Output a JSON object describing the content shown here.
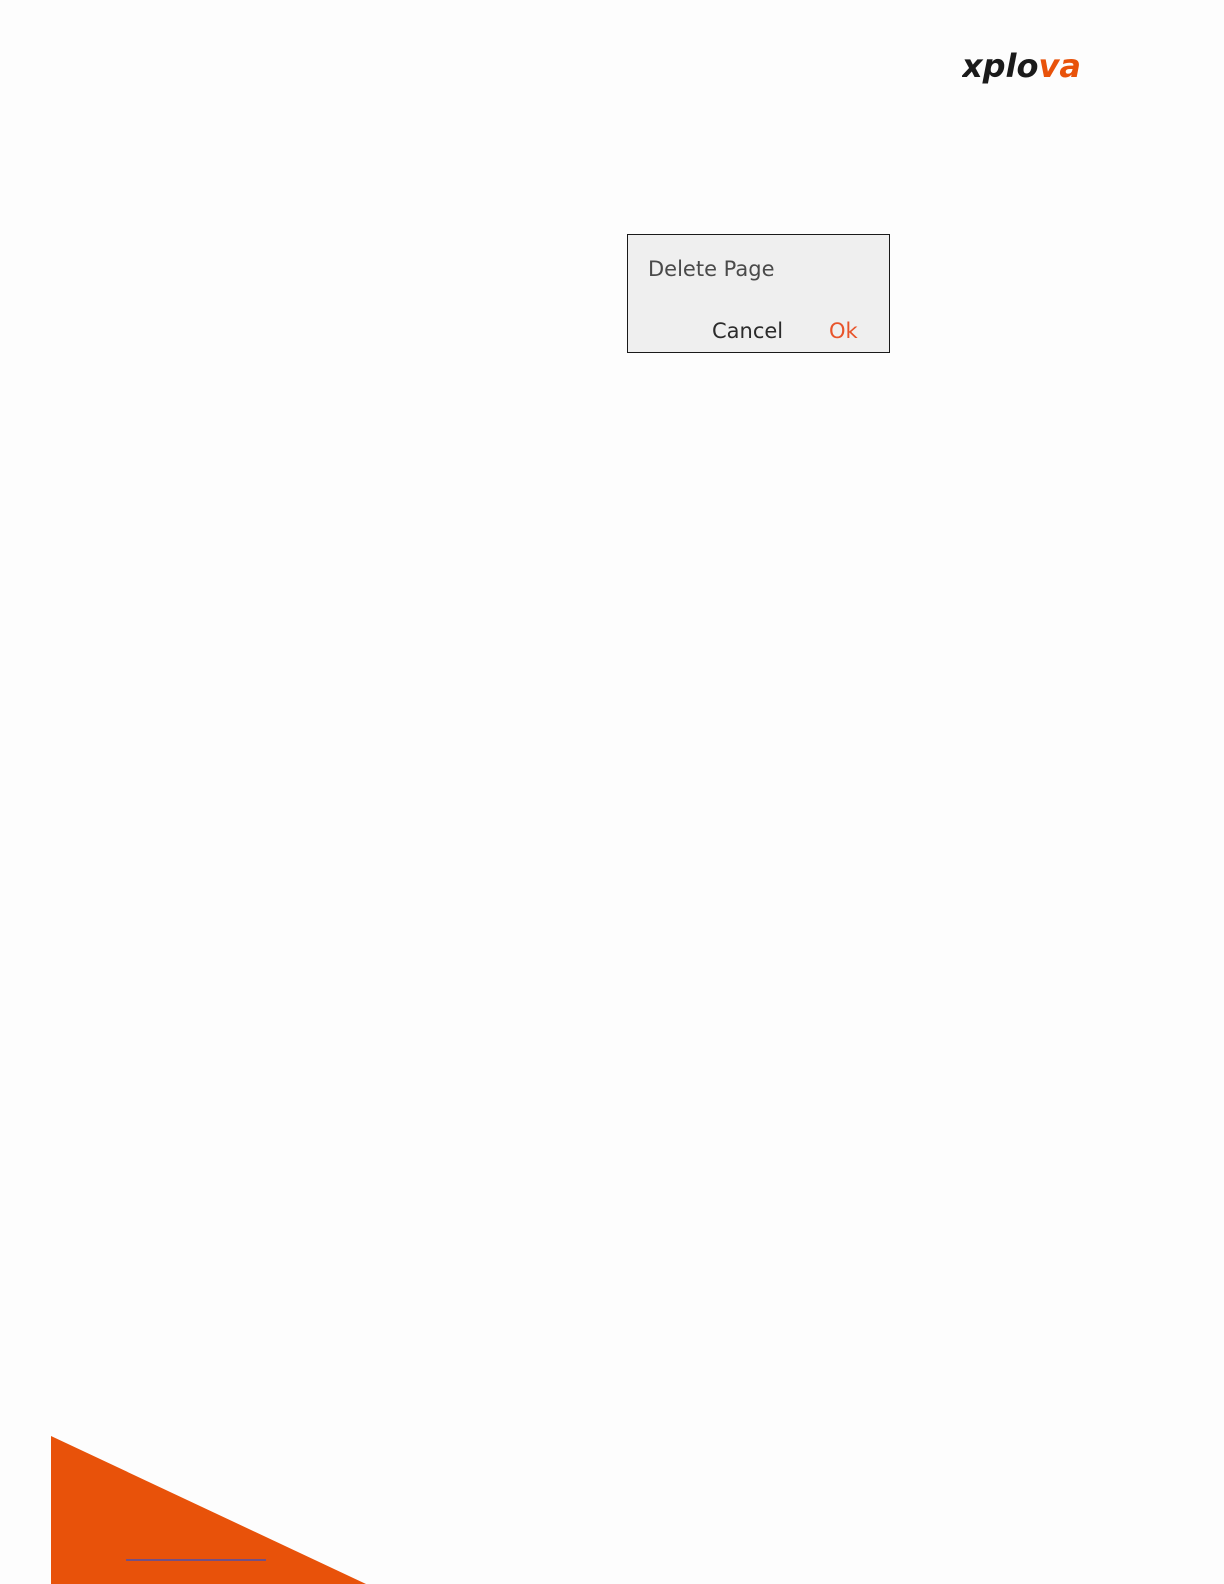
{
  "brand": {
    "logo_text_dark": "xplo",
    "logo_text_accent": "va",
    "color_dark": "#1a1a1a",
    "color_accent": "#e8520a"
  },
  "dialog": {
    "title": "Delete Page",
    "cancel_label": "Cancel",
    "ok_label": "Ok",
    "ok_color": "#e8542a"
  },
  "footer": {
    "corner_color": "#e8520a"
  }
}
